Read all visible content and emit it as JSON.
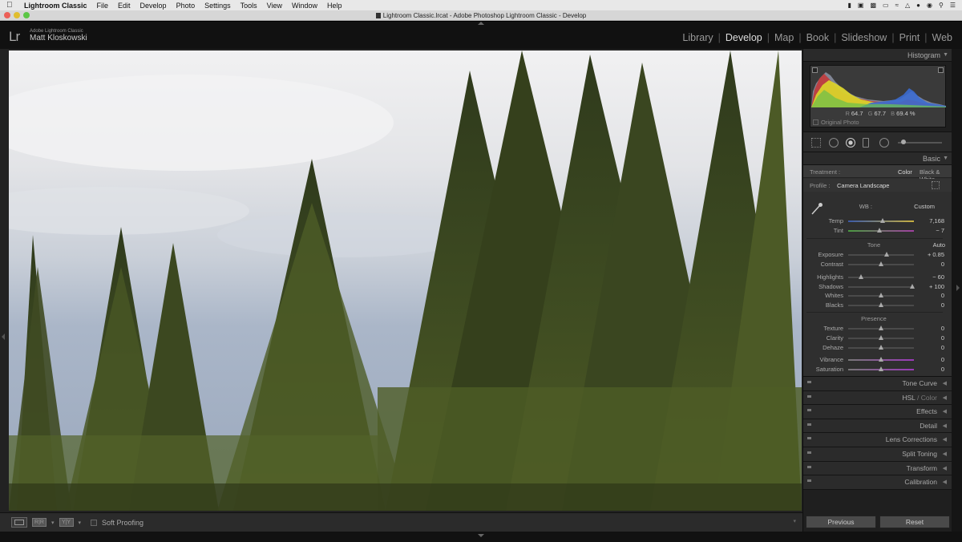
{
  "menubar": {
    "app_name": "Lightroom Classic",
    "items": [
      "File",
      "Edit",
      "Develop",
      "Photo",
      "Settings",
      "Tools",
      "View",
      "Window",
      "Help"
    ]
  },
  "window": {
    "title": "Lightroom Classic.lrcat - Adobe Photoshop Lightroom Classic - Develop"
  },
  "identity": {
    "logo": "Lr",
    "product": "Adobe Lightroom Classic",
    "user": "Matt Kloskowski"
  },
  "modules": {
    "library": "Library",
    "develop": "Develop",
    "map": "Map",
    "book": "Book",
    "slideshow": "Slideshow",
    "print": "Print",
    "web": "Web",
    "active": "Develop"
  },
  "histogram": {
    "header": "Histogram",
    "r_label": "R",
    "r_value": "64.7",
    "g_label": "G",
    "g_value": "67.7",
    "b_label": "B",
    "b_value": "69.4",
    "unit": "%",
    "original_photo": "Original Photo"
  },
  "basic": {
    "header": "Basic",
    "treatment_label": "Treatment :",
    "treatment_color": "Color",
    "treatment_bw": "Black & White",
    "profile_label": "Profile :",
    "profile_value": "Camera Landscape",
    "wb_label": "WB :",
    "wb_value": "Custom",
    "temp_label": "Temp",
    "temp_value": "7,168",
    "temp_pos": 0.52,
    "tint_label": "Tint",
    "tint_value": "− 7",
    "tint_pos": 0.48,
    "tone_label": "Tone",
    "auto_label": "Auto",
    "exposure_label": "Exposure",
    "exposure_value": "+ 0.85",
    "exposure_pos": 0.58,
    "contrast_label": "Contrast",
    "contrast_value": "0",
    "contrast_pos": 0.5,
    "highlights_label": "Highlights",
    "highlights_value": "− 60",
    "highlights_pos": 0.2,
    "shadows_label": "Shadows",
    "shadows_value": "+ 100",
    "shadows_pos": 0.98,
    "whites_label": "Whites",
    "whites_value": "0",
    "whites_pos": 0.5,
    "blacks_label": "Blacks",
    "blacks_value": "0",
    "blacks_pos": 0.5,
    "presence_label": "Presence",
    "texture_label": "Texture",
    "texture_value": "0",
    "texture_pos": 0.5,
    "clarity_label": "Clarity",
    "clarity_value": "0",
    "clarity_pos": 0.5,
    "dehaze_label": "Dehaze",
    "dehaze_value": "0",
    "dehaze_pos": 0.5,
    "vibrance_label": "Vibrance",
    "vibrance_value": "0",
    "vibrance_pos": 0.5,
    "saturation_label": "Saturation",
    "saturation_value": "0",
    "saturation_pos": 0.5
  },
  "panels": {
    "tone_curve": "Tone Curve",
    "hsl": "HSL",
    "hsl_sep": " / ",
    "color": "Color",
    "effects": "Effects",
    "detail": "Detail",
    "lens": "Lens Corrections",
    "split": "Split Toning",
    "transform": "Transform",
    "calibration": "Calibration"
  },
  "buttons": {
    "previous": "Previous",
    "reset": "Reset"
  },
  "toolbar": {
    "soft_proofing": "Soft Proofing"
  },
  "icons": {
    "view_mode": "loupe-view-icon",
    "before_after": "before-after-icon",
    "ref_view": "reference-view-icon"
  }
}
